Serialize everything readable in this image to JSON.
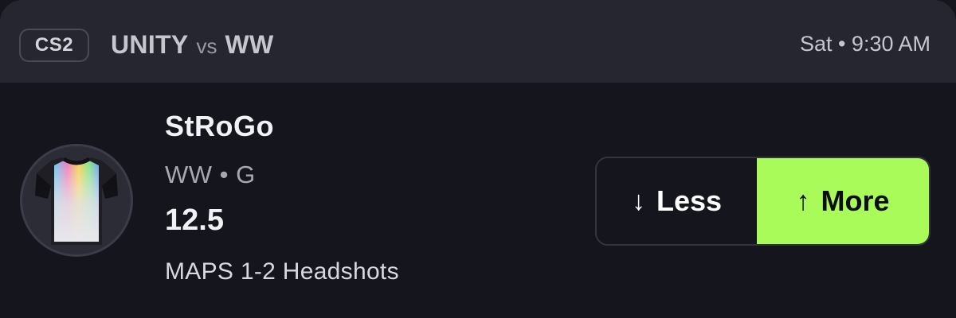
{
  "header": {
    "game": "CS2",
    "team_home": "UNITY",
    "vs": "vs",
    "team_away": "WW",
    "time": "Sat • 9:30 AM"
  },
  "player": {
    "name": "StRoGo",
    "team_position": "WW • G",
    "line": "12.5",
    "stat": "MAPS 1-2 Headshots",
    "avatar_icon": "jersey-icon"
  },
  "actions": {
    "less_label": "Less",
    "less_icon": "arrow-down-icon",
    "more_label": "More",
    "more_icon": "arrow-up-icon",
    "selected": "More"
  },
  "colors": {
    "background": "#15151e",
    "header": "#262630",
    "selected_accent": "#a8fb58"
  }
}
